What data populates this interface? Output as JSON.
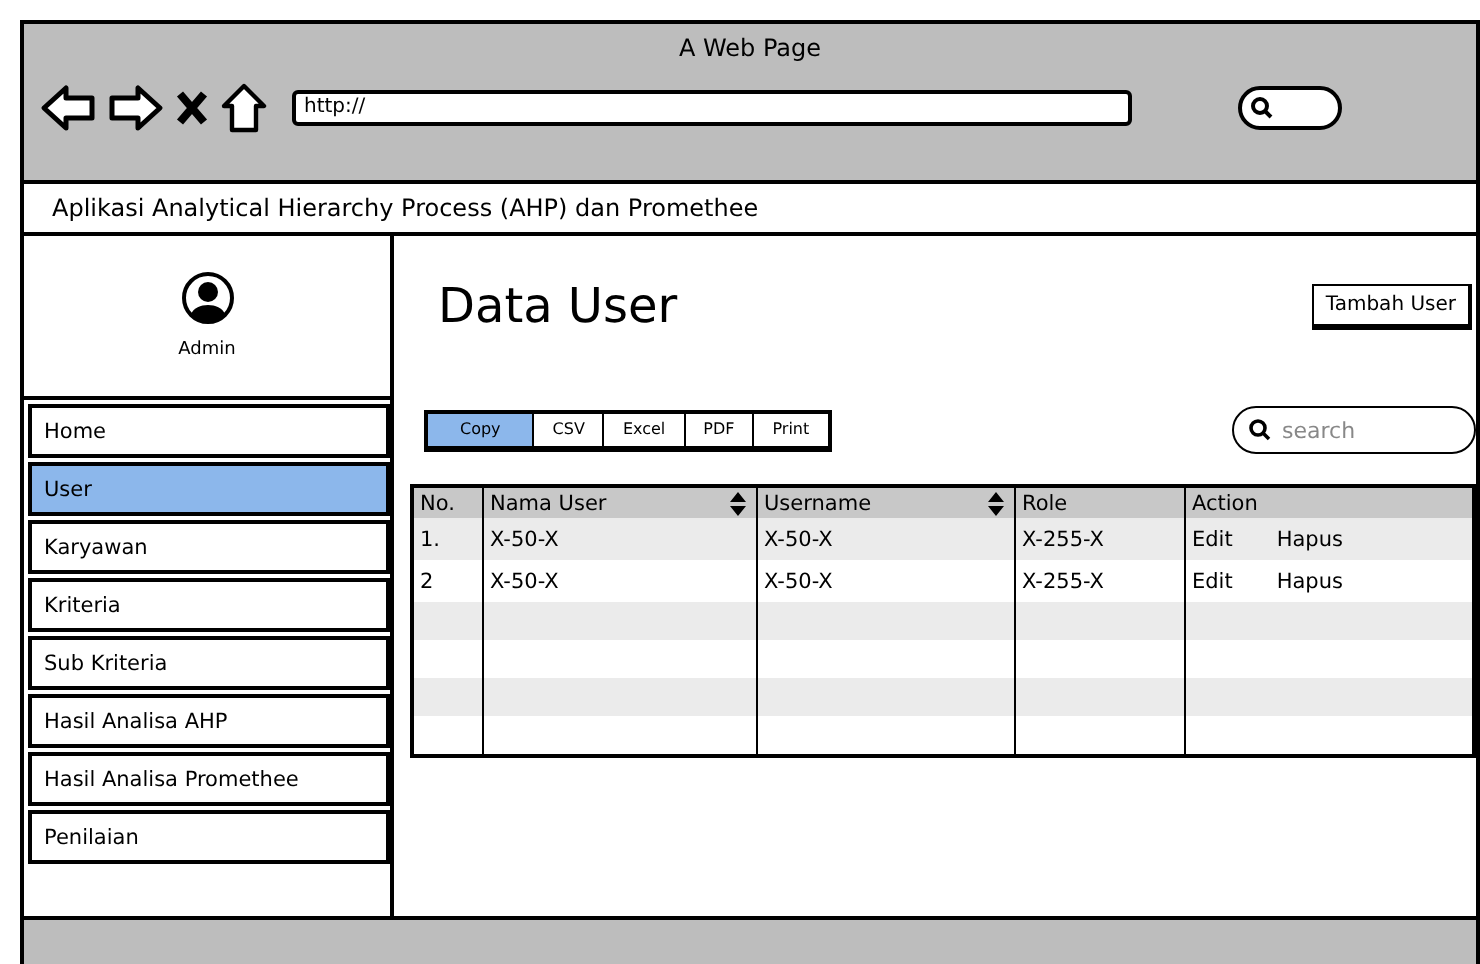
{
  "window": {
    "title": "A Web Page",
    "address": "http://"
  },
  "app_title": "Aplikasi Analytical Hierarchy Process (AHP) dan Promethee",
  "profile": {
    "name": "Admin"
  },
  "sidebar": {
    "items": [
      {
        "label": "Home",
        "selected": false
      },
      {
        "label": "User",
        "selected": true
      },
      {
        "label": "Karyawan",
        "selected": false
      },
      {
        "label": "Kriteria",
        "selected": false
      },
      {
        "label": "Sub Kriteria",
        "selected": false
      },
      {
        "label": "Hasil Analisa AHP",
        "selected": false
      },
      {
        "label": "Hasil Analisa Promethee",
        "selected": false
      },
      {
        "label": "Penilaian",
        "selected": false
      }
    ]
  },
  "page_title": "Data User",
  "add_button": "Tambah User",
  "export_buttons": [
    {
      "label": "Copy",
      "selected": true
    },
    {
      "label": "CSV",
      "selected": false
    },
    {
      "label": "Excel",
      "selected": false
    },
    {
      "label": "PDF",
      "selected": false
    },
    {
      "label": "Print",
      "selected": false
    }
  ],
  "search": {
    "placeholder": "search"
  },
  "table": {
    "columns": [
      {
        "label": "No.",
        "sortable": false
      },
      {
        "label": "Nama User",
        "sortable": true
      },
      {
        "label": "Username",
        "sortable": true
      },
      {
        "label": "Role",
        "sortable": false
      },
      {
        "label": "Action",
        "sortable": false
      }
    ],
    "rows": [
      {
        "no": "1.",
        "nama_user": "X-50-X",
        "username": "X-50-X",
        "role": "X-255-X",
        "actions": [
          "Edit",
          "Hapus"
        ]
      },
      {
        "no": "2",
        "nama_user": "X-50-X",
        "username": "X-50-X",
        "role": "X-255-X",
        "actions": [
          "Edit",
          "Hapus"
        ]
      }
    ]
  }
}
